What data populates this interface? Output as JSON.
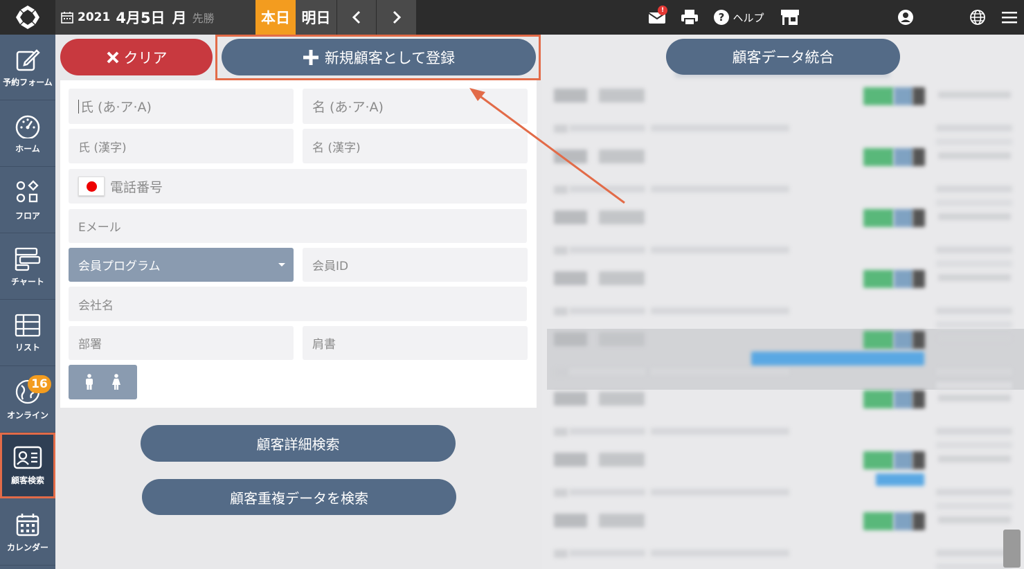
{
  "topbar": {
    "date": {
      "year": "2021",
      "month_day": "4月5日",
      "weekday": "月",
      "rokuyo": "先勝"
    },
    "today_label": "本日",
    "tomorrow_label": "明日",
    "mail_badge": "!",
    "help_label": "ヘルプ"
  },
  "sidebar": {
    "items": [
      {
        "label": "予約フォーム"
      },
      {
        "label": "ホーム"
      },
      {
        "label": "フロア"
      },
      {
        "label": "チャート"
      },
      {
        "label": "リスト"
      },
      {
        "label": "オンライン",
        "badge": "16"
      },
      {
        "label": "顧客検索"
      },
      {
        "label": "カレンダー"
      }
    ]
  },
  "actions": {
    "clear_label": "クリア",
    "register_label": "新規顧客として登録",
    "merge_label": "顧客データ統合",
    "detail_search_label": "顧客詳細検索",
    "duplicate_search_label": "顧客重複データを検索"
  },
  "form": {
    "last_name_kana_placeholder": "氏 (あ·ア·A)",
    "first_name_kana_placeholder": "名 (あ·ア·A)",
    "last_name_kanji_placeholder": "氏 (漢字)",
    "first_name_kanji_placeholder": "名 (漢字)",
    "phone_placeholder": "電話番号",
    "email_placeholder": "Eメール",
    "member_program_label": "会員プログラム",
    "member_id_placeholder": "会員ID",
    "company_placeholder": "会社名",
    "department_placeholder": "部署",
    "title_placeholder": "肩書"
  },
  "colors": {
    "topbar": "#2c2c2c",
    "sidebar": "#4d6078",
    "today": "#f39c1f",
    "clear": "#c8393f",
    "primary": "#546b87",
    "highlight": "#e26b48"
  }
}
